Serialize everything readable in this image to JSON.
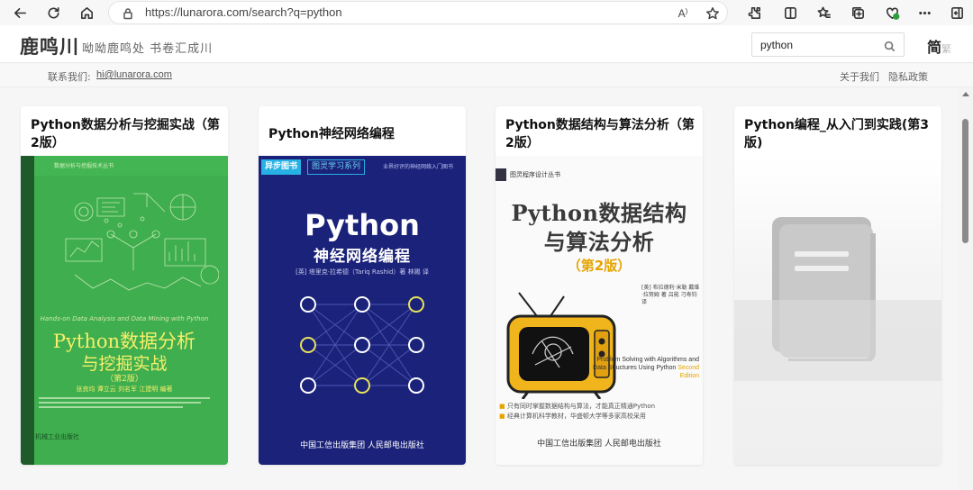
{
  "browser": {
    "url": "https://lunarora.com/search?q=python",
    "read_aloud_label": "A",
    "icons": [
      "back-icon",
      "refresh-icon",
      "home-icon",
      "lock-icon",
      "read-aloud-icon",
      "favorite-star-icon",
      "extensions-icon",
      "split-screen-icon",
      "favorites-icon",
      "collections-icon",
      "browser-essentials-icon",
      "more-icon",
      "sidebar-toggle-icon"
    ]
  },
  "site": {
    "title": "鹿鸣川",
    "slogan": "呦呦鹿鸣处 书卷汇成川",
    "lang_label": "简",
    "lang_other": "繁"
  },
  "search": {
    "value": "python",
    "placeholder": ""
  },
  "subheader": {
    "contact_label": "联系我们:",
    "contact_email": "hi@lunarora.com",
    "about": "关于我们",
    "privacy": "隐私政策"
  },
  "books": [
    {
      "title": "Python数据分析与挖掘实战（第2版）",
      "cover": {
        "series_top": "数据分析与挖掘技术丛书",
        "subtitle_en": "Hands-on Data Analysis and Data Mining with Python",
        "title_line1": "Python数据分析",
        "title_line2": "与挖掘实战",
        "edition": "（第2版）",
        "authors": "张良均  谭立云  刘名军  江建明  编著",
        "publisher": "机械工业出版社"
      }
    },
    {
      "title": "Python神经网络编程",
      "cover": {
        "badge1": "异步图书",
        "badge2": "图灵学习系列",
        "tagline": "业界好评的神经网络入门图书",
        "title_en": "Python",
        "title_zh": "神经网络编程",
        "authors": "[英] 塔里克·拉希德（Tariq Rashid）著  林赐 译",
        "publisher": "中国工信出版集团   人民邮电出版社"
      }
    },
    {
      "title": "Python数据结构与算法分析（第2版）",
      "cover": {
        "series": "图灵程序设计丛书",
        "title_line1": "Python数据结构",
        "title_line2": "与算法分析",
        "edition": "（第2版）",
        "authors": "[美] 布拉德利·米勒  戴维·拉努姆 著  吕能 刁寿钧 译",
        "title_en": "Problem Solving with Algorithms and Data Structures Using Python",
        "edition_en": "Second Edition",
        "bullet1": "只有同时掌握数据结构与算法，才能真正精通Python",
        "bullet2": "经典计算机科学教材，华盛顿大学等多家高校采用",
        "publisher": "中国工信出版集团   人民邮电出版社"
      }
    },
    {
      "title": "Python编程_从入门到实践(第3版)",
      "cover": {
        "placeholder_icon": "book-placeholder-icon"
      }
    }
  ],
  "colors": {
    "cover1_bg": "#3fae4f",
    "cover1_text": "#f6ef6a",
    "cover2_bg": "#1b2279",
    "cover3_accent": "#e5a400"
  }
}
